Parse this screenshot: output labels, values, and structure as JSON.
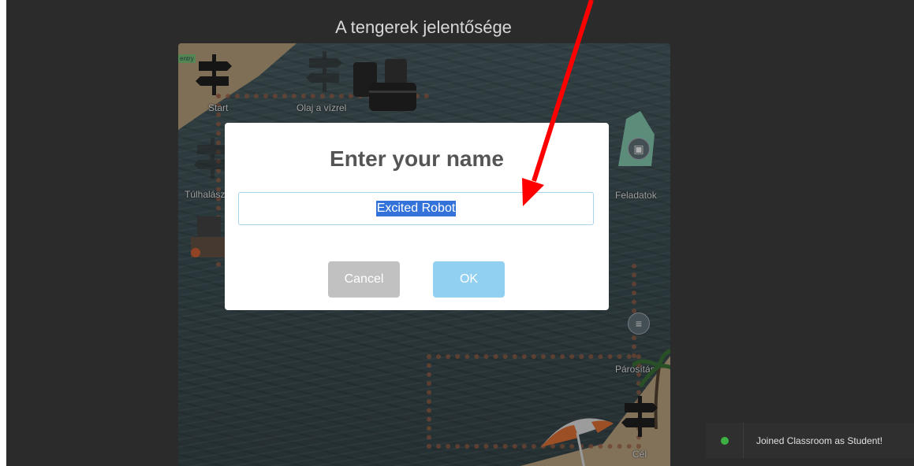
{
  "game": {
    "title": "A tengerek jelentősége"
  },
  "board": {
    "entry_badge": "entry",
    "stations": {
      "start": "Start",
      "olaj": "Olaj a vízrel",
      "tulhalasz": "Túlhalász",
      "feladatok": "Feladatok",
      "parositas": "Párosítás",
      "cel": "Cél"
    }
  },
  "dialog": {
    "title": "Enter your name",
    "name_value": "Excited Robot",
    "cancel_label": "Cancel",
    "ok_label": "OK"
  },
  "toast": {
    "message": "Joined Classroom as Student!"
  },
  "colors": {
    "ok_button": "#92d0f2",
    "cancel_button": "#c1c1c1",
    "selection": "#3373d9",
    "toast_dot": "#3cb043",
    "annotation_arrow": "#ff0000"
  }
}
